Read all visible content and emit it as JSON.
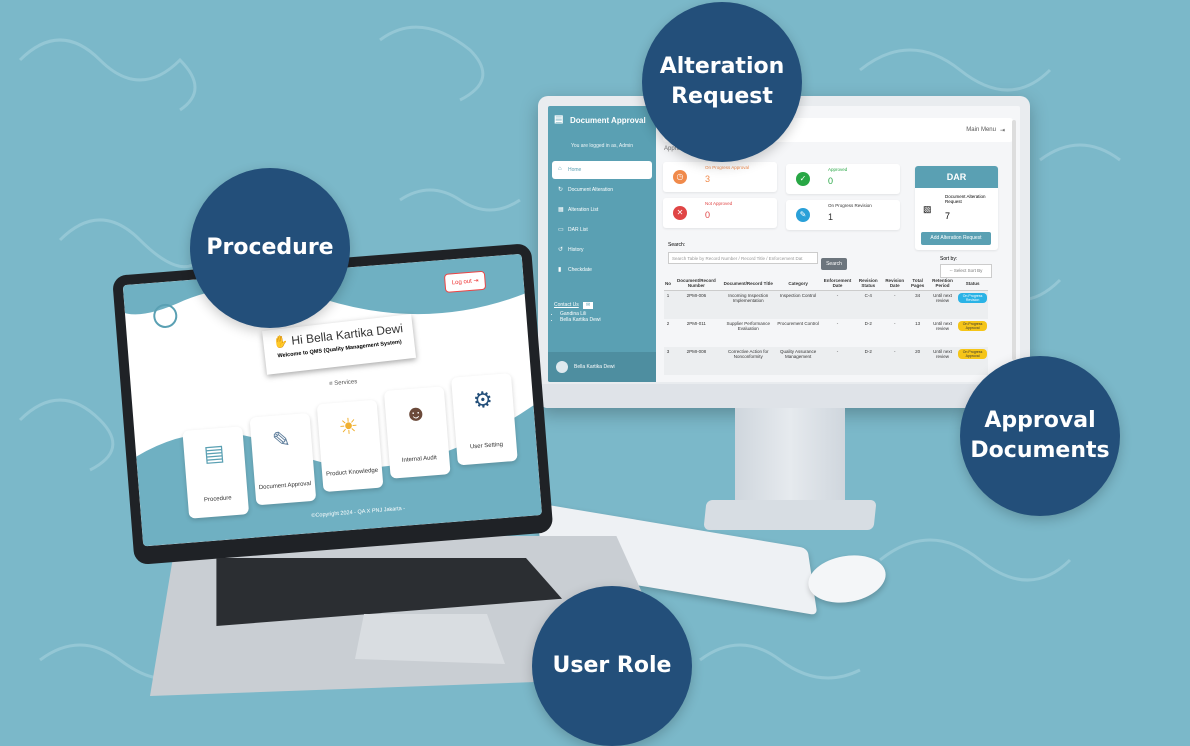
{
  "labels": {
    "procedure": "Procedure",
    "alteration": "Alteration Request",
    "approval": "Approval Documents",
    "user_role": "User Role"
  },
  "colors": {
    "background": "#7bb8c9",
    "circle": "#234f7a",
    "accent": "#5aa0b3"
  },
  "imac": {
    "sidebar": {
      "title": "Document Approval",
      "title_icon": "document-icon",
      "logged_in": "You are logged in as, Admin",
      "items": [
        {
          "label": "Home",
          "icon": "home-icon"
        },
        {
          "label": "Document Alteration",
          "icon": "refresh-icon"
        },
        {
          "label": "Alteration List",
          "icon": "list-icon"
        },
        {
          "label": "DAR List",
          "icon": "folder-icon"
        },
        {
          "label": "History",
          "icon": "history-icon"
        },
        {
          "label": "Checkdate",
          "icon": "trash-icon"
        }
      ],
      "contact_label": "Contact Us",
      "contacts": [
        "Gandina Lili",
        "Bella Kartika Dewi"
      ],
      "user_name": "Bella Kartika Dewi"
    },
    "topbar": {
      "main_menu": "Main Menu"
    },
    "breadcrumb": "Appro",
    "stats": [
      {
        "label": "On Progress Approval",
        "value": "3",
        "color": "#f08a4b",
        "icon": "clock-icon"
      },
      {
        "label": "Approved",
        "value": "0",
        "color": "#28a745",
        "icon": "check-icon"
      },
      {
        "label": "Not Approved",
        "value": "0",
        "color": "#e04545",
        "icon": "x-icon"
      },
      {
        "label": "On Progress Revision",
        "value": "1",
        "color": "#2aa0d8",
        "icon": "edit-icon"
      }
    ],
    "dar": {
      "title": "DAR",
      "label": "Document Alteration Request",
      "value": "7",
      "button": "Add Alteration Request"
    },
    "search": {
      "label": "Search:",
      "placeholder": "Search Table by Record Number / Record Title / Enforcement Dat",
      "button": "Search"
    },
    "sort": {
      "label": "Sort by:",
      "value": "-- Select Sort By"
    },
    "table": {
      "headers": [
        "No",
        "Document/Record Number",
        "Document/Record Title",
        "Category",
        "Enforcement Date",
        "Revision Status",
        "Revision Date",
        "Total Pages",
        "Retention Period",
        "Status"
      ],
      "rows": [
        [
          "1",
          "2PMI-006",
          "Incoming Inspection Implementation",
          "Inspection Control",
          "-",
          "C-4",
          "-",
          "34",
          "Until next review",
          "On Progress Revision"
        ],
        [
          "2",
          "2PMI-011",
          "Supplier Performance Evaluation",
          "Procurement Control",
          "-",
          "D-2",
          "-",
          "13",
          "Until next review",
          "On Progress Approval"
        ],
        [
          "3",
          "2PMI-008",
          "Corrective Action for Nonconformity",
          "Quality Assurance Management",
          "-",
          "D-2",
          "-",
          "20",
          "Until next review",
          "On Progress Approval"
        ]
      ]
    }
  },
  "laptop": {
    "logout": "Log out",
    "greeting": "Hi Bella Kartika Dewi",
    "welcome": "Welcome to QMS (Quality Management System)",
    "services": "Services",
    "cards": [
      {
        "label": "Procedure",
        "icon": "procedure-icon"
      },
      {
        "label": "Document Approval",
        "icon": "document-approval-icon"
      },
      {
        "label": "Product Knowledge",
        "icon": "lightbulb-icon"
      },
      {
        "label": "Internal Audit",
        "icon": "audit-person-icon"
      },
      {
        "label": "User Setting",
        "icon": "user-setting-icon"
      }
    ],
    "copyright": "©Copyright 2024 - QA X PNJ Jakarta -"
  }
}
